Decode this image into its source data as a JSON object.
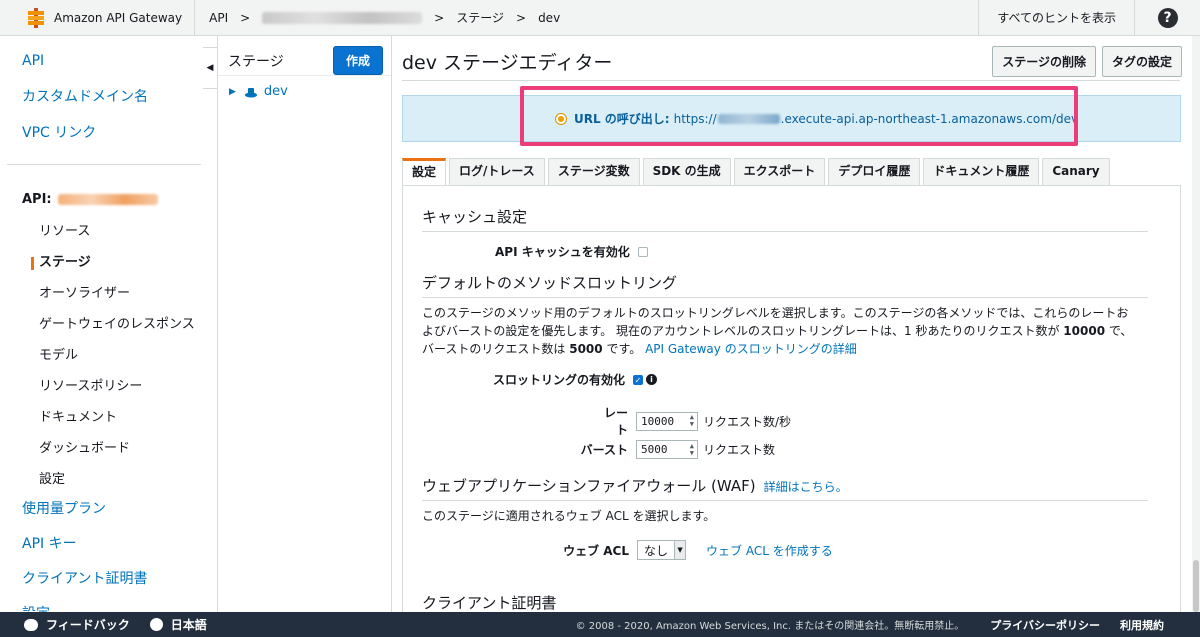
{
  "header": {
    "brand": "Amazon API Gateway",
    "crumb_api": "API",
    "crumb_sep": ">",
    "crumb_stage": "ステージ",
    "crumb_dev": "dev",
    "hints": "すべてのヒントを表示",
    "help": "?"
  },
  "leftnav": {
    "top_items": [
      "API",
      "カスタムドメイン名",
      "VPC リンク"
    ],
    "api_label": "API:",
    "sub_items": [
      "リソース",
      "ステージ",
      "オーソライザー",
      "ゲートウェイのレスポンス",
      "モデル",
      "リソースポリシー",
      "ドキュメント",
      "ダッシュボード",
      "設定"
    ],
    "active_sub": "ステージ",
    "bottom_items": [
      "使用量プラン",
      "API キー",
      "クライアント証明書",
      "設定"
    ]
  },
  "stages": {
    "title": "ステージ",
    "create": "作成",
    "tree_item": "dev"
  },
  "editor": {
    "title": "dev ステージエディター",
    "delete_stage": "ステージの削除",
    "tag_settings": "タグの設定",
    "url_label": "URL の呼び出し:",
    "url_prefix": "https://",
    "url_suffix": ".execute-api.ap-northeast-1.amazonaws.com/dev",
    "tabs": [
      "設定",
      "ログ/トレース",
      "ステージ変数",
      "SDK の生成",
      "エクスポート",
      "デプロイ履歴",
      "ドキュメント履歴",
      "Canary"
    ],
    "active_tab": "設定",
    "cache_title": "キャッシュ設定",
    "cache_enable": "API キャッシュを有効化",
    "throttle_title": "デフォルトのメソッドスロットリング",
    "throttle_desc_1": "このステージのメソッド用のデフォルトのスロットリングレベルを選択します。このステージの各メソッドでは、これらのレートお",
    "throttle_desc_2a": "よびバーストの設定を優先します。 現在のアカウントレベルのスロットリングレートは、1 秒あたりのリクエスト数が ",
    "throttle_desc_2b": "10000",
    "throttle_desc_2c": " で、",
    "throttle_desc_3a": "バーストのリクエスト数は ",
    "throttle_desc_3b": "5000",
    "throttle_desc_3c": " です。",
    "throttle_link": "API Gateway のスロットリングの詳細",
    "throttle_enable": "スロットリングの有効化",
    "rate_label": "レート",
    "rate_value": "10000",
    "rate_unit": "リクエスト数/秒",
    "burst_label": "バースト",
    "burst_value": "5000",
    "burst_unit": "リクエスト数",
    "waf_title": "ウェブアプリケーションファイアウォール (WAF)",
    "waf_link": "詳細はこちら。",
    "waf_desc": "このステージに適用されるウェブ ACL を選択します。",
    "acl_label": "ウェブ ACL",
    "acl_value": "なし",
    "acl_create": "ウェブ ACL を作成する",
    "client_cert_title": "クライアント証明書"
  },
  "footer": {
    "feedback": "フィードバック",
    "language": "日本語",
    "copyright": "© 2008 - 2020, Amazon Web Services, Inc. またはその関連会社。無断転用禁止。",
    "privacy": "プライバシーポリシー",
    "terms": "利用規約"
  },
  "colors": {
    "accent": "#ec7211",
    "link": "#0073bb",
    "highlight": "#ec3d7a",
    "footer_bg": "#232f3e"
  }
}
